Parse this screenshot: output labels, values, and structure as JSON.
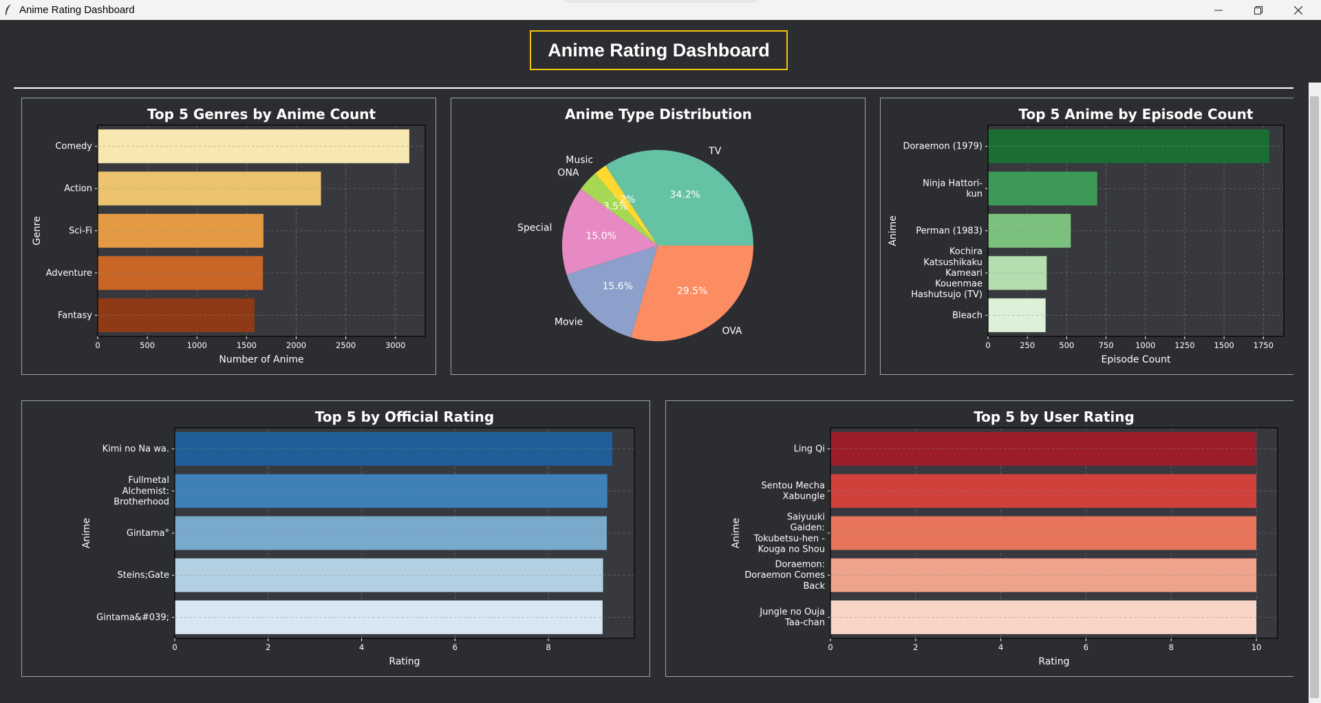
{
  "window": {
    "title": "Anime Rating Dashboard",
    "app_icon": "feather-icon"
  },
  "dashboard": {
    "title": "Anime Rating Dashboard"
  },
  "colors": {
    "background": "#2b2d31",
    "plot_bg": "#37393e",
    "title_border": "#f4c20d"
  },
  "chart_data": [
    {
      "id": "genres",
      "type": "bar",
      "orientation": "horizontal",
      "title": "Top 5 Genres by Anime Count",
      "xlabel": "Number of Anime",
      "ylabel": "Genre",
      "categories": [
        "Comedy",
        "Action",
        "Sci-Fi",
        "Adventure",
        "Fantasy"
      ],
      "values": [
        3140,
        2250,
        1670,
        1665,
        1580
      ],
      "colors": [
        "#f7e7b0",
        "#ecc46f",
        "#e39a42",
        "#c96526",
        "#8f3a17"
      ],
      "xlim": [
        0,
        3300
      ],
      "xticks": [
        0,
        500,
        1000,
        1500,
        2000,
        2500,
        3000
      ],
      "grid": true
    },
    {
      "id": "types",
      "type": "pie",
      "title": "Anime Type Distribution",
      "slices": [
        {
          "label": "TV",
          "value": 34.2,
          "pct": "34.2%",
          "color": "#66c2a5"
        },
        {
          "label": "Music",
          "value": 2.2,
          "pct": "2.2%",
          "color": "#ffd92f"
        },
        {
          "label": "ONA",
          "value": 3.5,
          "pct": "3.5%",
          "color": "#a6d854"
        },
        {
          "label": "Special",
          "value": 15.0,
          "pct": "15.0%",
          "color": "#e78ac3"
        },
        {
          "label": "Movie",
          "value": 15.6,
          "pct": "15.6%",
          "color": "#8da0cb"
        },
        {
          "label": "OVA",
          "value": 29.5,
          "pct": "29.5%",
          "color": "#fc8d62"
        }
      ]
    },
    {
      "id": "episodes",
      "type": "bar",
      "orientation": "horizontal",
      "title": "Top 5 Anime by Episode Count",
      "xlabel": "Episode Count",
      "ylabel": "Anime",
      "categories": [
        "Doraemon (1979)",
        "Ninja Hattori-\nkun",
        "Perman (1983)",
        "Kochira\nKatsushikaku\nKameari\nKouenmae\nHashutsujo (TV)",
        "Bleach"
      ],
      "values": [
        1787,
        694,
        526,
        373,
        366
      ],
      "colors": [
        "#1a6e34",
        "#3d9a56",
        "#7cc07e",
        "#b4deb0",
        "#ddf1d8"
      ],
      "xlim": [
        0,
        1880
      ],
      "xticks": [
        0,
        250,
        500,
        750,
        1000,
        1250,
        1500,
        1750
      ],
      "grid": true
    },
    {
      "id": "official",
      "type": "bar",
      "orientation": "horizontal",
      "title": "Top 5 by Official Rating",
      "xlabel": "Rating",
      "ylabel": "Anime",
      "categories": [
        "Kimi no Na wa.",
        "Fullmetal\nAlchemist:\nBrotherhood",
        "Gintama°",
        "Steins;Gate",
        "Gintama&#039;"
      ],
      "values": [
        9.37,
        9.26,
        9.25,
        9.17,
        9.16
      ],
      "colors": [
        "#1f5e98",
        "#3e80b8",
        "#79aacc",
        "#b2d0e2",
        "#d7e6f2"
      ],
      "xlim": [
        0,
        9.84
      ],
      "xticks": [
        0,
        2,
        4,
        6,
        8
      ],
      "grid": true
    },
    {
      "id": "user",
      "type": "bar",
      "orientation": "horizontal",
      "title": "Top 5 by User Rating",
      "xlabel": "Rating",
      "ylabel": "Anime",
      "categories": [
        "Ling Qi",
        "Sentou Mecha\nXabungle",
        "Saiyuuki\nGaiden:\nTokubetsu-hen -\nKouga no Shou",
        "Doraemon:\nDoraemon Comes\nBack",
        "Jungle no Ouja\nTaa-chan"
      ],
      "values": [
        10,
        10,
        10,
        10,
        10
      ],
      "colors": [
        "#9d1e2b",
        "#d1413b",
        "#e6755c",
        "#efa38a",
        "#f8d5c6"
      ],
      "xlim": [
        0,
        10.5
      ],
      "xticks": [
        0,
        2,
        4,
        6,
        8,
        10
      ],
      "grid": true
    }
  ]
}
